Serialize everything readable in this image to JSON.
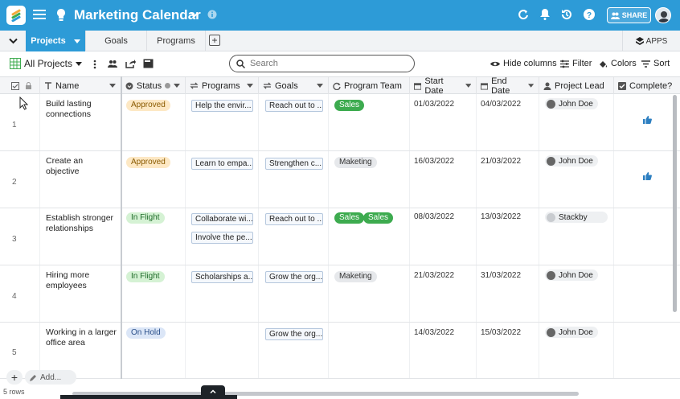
{
  "app": {
    "title": "Marketing Calendar",
    "share_label": "SHARE"
  },
  "colors": {
    "brand": "#2d9bd7",
    "approved": "#fde8c4",
    "in_flight": "#d5f2d4",
    "on_hold": "#dbe6f7",
    "sales": "#3dab4f",
    "gray_chip": "#e6e8eb"
  },
  "tabs": [
    {
      "label": "Projects",
      "active": true
    },
    {
      "label": "Goals",
      "active": false
    },
    {
      "label": "Programs",
      "active": false
    }
  ],
  "apps_label": "APPS",
  "toolbar": {
    "view_label": "All Projects",
    "search_placeholder": "Search",
    "hide_columns": "Hide columns",
    "filter": "Filter",
    "colors": "Colors",
    "sort": "Sort"
  },
  "columns": {
    "name": "Name",
    "status": "Status",
    "programs": "Programs",
    "goals": "Goals",
    "program_team": "Program Team",
    "start_date": "Start Date",
    "end_date": "End Date",
    "project_lead": "Project Lead",
    "complete": "Complete?"
  },
  "rows": [
    {
      "num": "1",
      "name": "Build lasting connections",
      "status": "Approved",
      "programs": [
        "Help the envir..."
      ],
      "goals": "Reach out to ...",
      "teams": [
        "Sales"
      ],
      "start": "01/03/2022",
      "end": "04/03/2022",
      "lead": "John Doe",
      "complete": true
    },
    {
      "num": "2",
      "name": "Create an objective",
      "status": "Approved",
      "programs": [
        "Learn to empa..."
      ],
      "goals": "Strengthen c...",
      "teams": [
        "Maketing"
      ],
      "start": "16/03/2022",
      "end": "21/03/2022",
      "lead": "John Doe",
      "complete": true
    },
    {
      "num": "3",
      "name": "Establish stronger relationships",
      "status": "In Flight",
      "programs": [
        "Collaborate wi...",
        "Involve the pe..."
      ],
      "goals": "Reach out to ...",
      "teams": [
        "Sales",
        "Sales"
      ],
      "start": "08/03/2022",
      "end": "13/03/2022",
      "lead": "Stackby",
      "complete": false
    },
    {
      "num": "4",
      "name": "Hiring more employees",
      "status": "In Flight",
      "programs": [
        "Scholarships a..."
      ],
      "goals": "Grow the org...",
      "teams": [
        "Maketing"
      ],
      "start": "21/03/2022",
      "end": "31/03/2022",
      "lead": "John Doe",
      "complete": false
    },
    {
      "num": "5",
      "name": "Working in a larger office area",
      "status": "On Hold",
      "programs": [],
      "goals": "Grow the org...",
      "teams": [],
      "start": "14/03/2022",
      "end": "15/03/2022",
      "lead": "John Doe",
      "complete": false
    }
  ],
  "footer": {
    "add_label": "Add...",
    "rows_count": "5 rows"
  }
}
